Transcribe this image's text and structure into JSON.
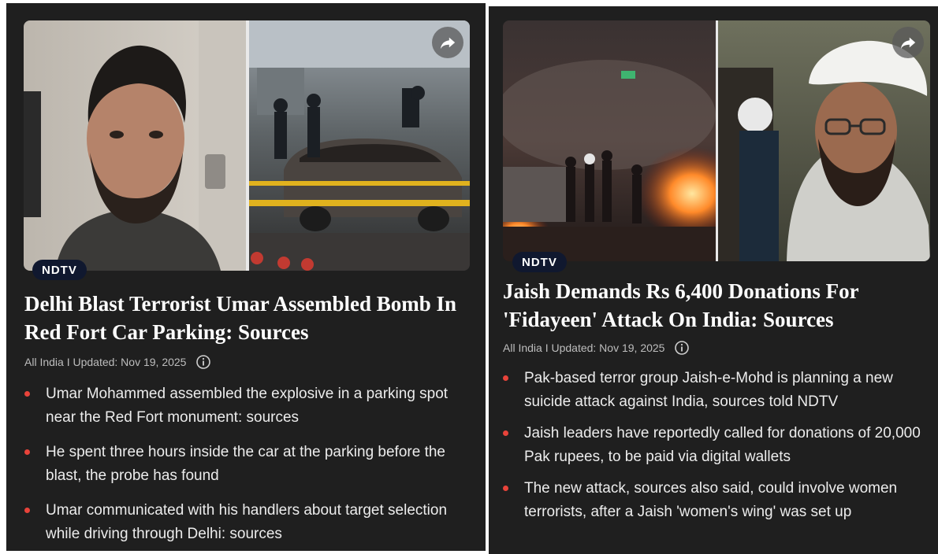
{
  "colors": {
    "card_background": "#1f1f1f",
    "bullet_accent": "#e8433a",
    "badge_background": "#10182f",
    "meta_text": "#bdbdbd"
  },
  "cards": [
    {
      "badge": "NDTV",
      "headline": "Delhi Blast Terrorist Umar Assembled Bomb In Red Fort Car Parking: Sources",
      "meta": "All India I Updated: Nov 19, 2025",
      "share_icon": "share-arrow-icon",
      "info_icon": "info-icon",
      "bullets": [
        "Umar Mohammed assembled the explosive in a parking spot near the Red Fort monument: sources",
        "He spent three hours inside the car at the parking before the blast, the probe has found",
        "Umar communicated with his handlers about target selection while driving through Delhi: sources"
      ]
    },
    {
      "badge": "NDTV",
      "headline": "Jaish Demands Rs 6,400 Donations For 'Fidayeen' Attack On India: Sources",
      "meta": "All India I Updated: Nov 19, 2025",
      "share_icon": "share-arrow-icon",
      "info_icon": "info-icon",
      "bullets": [
        "Pak-based terror group Jaish-e-Mohd is planning a new suicide attack against India, sources told NDTV",
        "Jaish leaders have reportedly called for donations of 20,000 Pak rupees, to be paid via digital wallets",
        "The new attack, sources also said, could involve women terrorists, after a Jaish 'women's wing' was set up"
      ]
    }
  ]
}
